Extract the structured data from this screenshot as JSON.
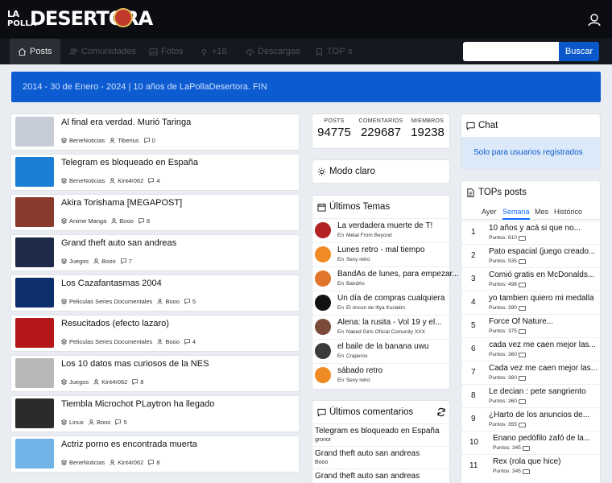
{
  "header": {
    "logo_la": "LA",
    "logo_polla": "POLLA",
    "logo_desertora": "DESERTORA"
  },
  "nav": [
    {
      "label": "Posts",
      "icon": "home-icon"
    },
    {
      "label": "Comunidades",
      "icon": "people-icon"
    },
    {
      "label": "Fotos",
      "icon": "images-icon"
    },
    {
      "label": "+18",
      "icon": "gender-icon"
    },
    {
      "label": "Descargas",
      "icon": "cloud-download-icon"
    },
    {
      "label": "TOP´s",
      "icon": "bookmark-icon"
    }
  ],
  "search": {
    "button_label": "Buscar",
    "value": ""
  },
  "announcement": "2014 - 30 de Enero - 2024 | 10 años de LaPollaDesertora. FIN",
  "posts": [
    {
      "title": "Al final era verdad. Murió Taringa",
      "category": "BeneNoticias",
      "author": "Tiberius",
      "comments": "0",
      "thumb": "#c7cdd6"
    },
    {
      "title": "Telegram es bloqueado en España",
      "category": "BeneNoticias",
      "author": "Kint4r062",
      "comments": "4",
      "thumb": "#1c7fd6"
    },
    {
      "title": "Akira Torishama [MEGAPOST]",
      "category": "Anime Manga",
      "author": "Booo",
      "comments": "8",
      "thumb": "#8a3a2c"
    },
    {
      "title": "Grand theft auto san andreas",
      "category": "Juegos",
      "author": "Booo",
      "comments": "7",
      "thumb": "#1d2a4a"
    },
    {
      "title": "Los Cazafantasmas 2004",
      "category": "Peliculas Series Documentales",
      "author": "Booo",
      "comments": "5",
      "thumb": "#0d2f6b"
    },
    {
      "title": "Resucitados (efecto lazaro)",
      "category": "Peliculas Series Documentales",
      "author": "Booo",
      "comments": "4",
      "thumb": "#b41818"
    },
    {
      "title": "Los 10 datos mas curiosos de la NES",
      "category": "Juegos",
      "author": "Kint4r062",
      "comments": "8",
      "thumb": "#b8b8b8"
    },
    {
      "title": "Tiembla Microchot PLaytron ha llegado",
      "category": "Linux",
      "author": "Booo",
      "comments": "5",
      "thumb": "#2b2b2b"
    },
    {
      "title": "Actriz porno es encontrada muerta",
      "category": "BeneNoticias",
      "author": "Kint4r062",
      "comments": "8",
      "thumb": "#6fb3e8"
    }
  ],
  "stats": [
    {
      "label": "POSTS",
      "value": "94775"
    },
    {
      "label": "COMENTARIOS",
      "value": "229687"
    },
    {
      "label": "MIEMBROS",
      "value": "19238"
    }
  ],
  "modo_claro": "Modo claro",
  "ultimos_temas": {
    "title": "Últimos Temas",
    "items": [
      {
        "title": "La verdadera muerte de T!",
        "prefix": "En",
        "community": "Metal From Beyond",
        "avatar": "#b22222"
      },
      {
        "title": "Lunes retro - mal tiempo",
        "prefix": "En",
        "community": "Sexy retro",
        "avatar": "#f08a24"
      },
      {
        "title": "BandAs de lunes, para empezar...",
        "prefix": "En",
        "community": "BandAs",
        "avatar": "#e0762a"
      },
      {
        "title": "Un día de compras cualquiera",
        "prefix": "En",
        "community": "El rincon de Illya Kuriakin",
        "avatar": "#111111"
      },
      {
        "title": "Alena: la rusita - Vol 19 y el...",
        "prefix": "En",
        "community": "Naked Girls Oficial Comunity XXX",
        "avatar": "#7a4b3a"
      },
      {
        "title": "el baile de la banana uwu",
        "prefix": "En",
        "community": "Craperos",
        "avatar": "#3b3b3b"
      },
      {
        "title": "sábado retro",
        "prefix": "En",
        "community": "Sexy retro",
        "avatar": "#f08a24"
      }
    ]
  },
  "ultimos_comentarios": {
    "title": "Últimos comentarios",
    "items": [
      {
        "title": "Telegram es bloqueado en España",
        "author": "gronor"
      },
      {
        "title": "Grand theft auto san andreas",
        "author": "Booo"
      },
      {
        "title": "Grand theft auto san andreas",
        "author": ""
      }
    ]
  },
  "chat": {
    "title": "Chat",
    "message": "Solo para usuarios registrados"
  },
  "tops": {
    "title": "TOPs posts",
    "tabs": [
      "Ayer",
      "Semana",
      "Mes",
      "Histórico"
    ],
    "active_tab": "Semana",
    "points_label": "Puntos:",
    "items": [
      {
        "rank": "1",
        "title": "10 años y acá si que no...",
        "points": "610"
      },
      {
        "rank": "2",
        "title": "Pato espacial (juego creado...",
        "points": "535"
      },
      {
        "rank": "3",
        "title": "Comió gratis en McDonalds...",
        "points": "498"
      },
      {
        "rank": "4",
        "title": "yo tambien quiero mi medalla",
        "points": "390"
      },
      {
        "rank": "5",
        "title": "Force Of Nature...",
        "points": "375"
      },
      {
        "rank": "6",
        "title": "cada vez me caen mejor las...",
        "points": "360"
      },
      {
        "rank": "7",
        "title": "Cada vez me caen mejor las...",
        "points": "360"
      },
      {
        "rank": "8",
        "title": "Le decian : pete sangriento",
        "points": "360"
      },
      {
        "rank": "9",
        "title": "¿Harto de los anuncios de...",
        "points": "355"
      },
      {
        "rank": "10",
        "title": "Enano pedófilo zafó de la...",
        "points": "345"
      },
      {
        "rank": "11",
        "title": "Rex (rola que hice)",
        "points": "345"
      }
    ]
  },
  "colors": {
    "accent": "#0d5bd1",
    "topbar": "#0b0d12",
    "navbar": "#15181e"
  }
}
